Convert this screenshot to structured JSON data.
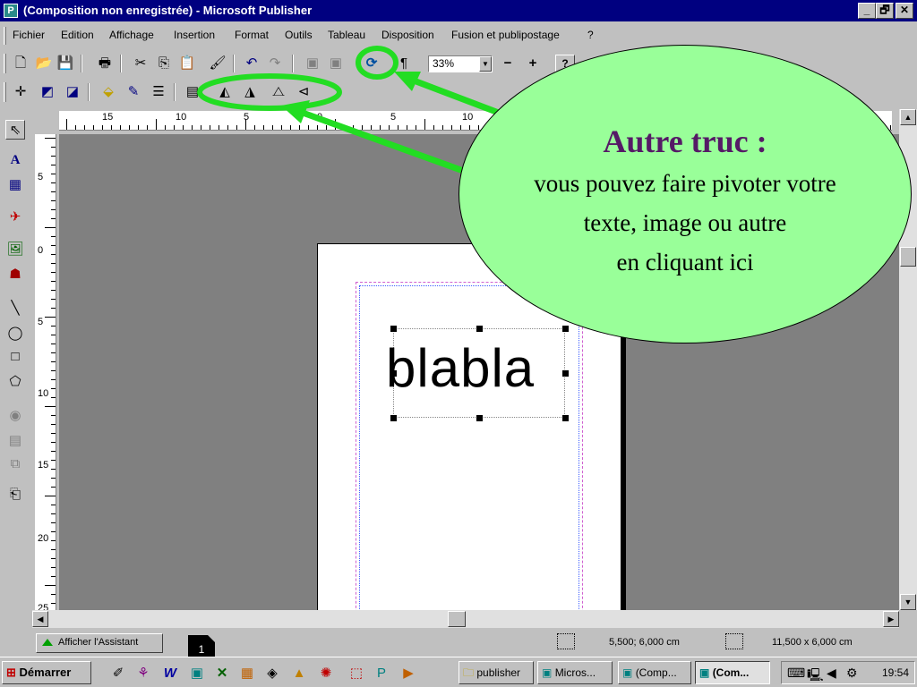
{
  "window": {
    "title": "(Composition non enregistrée) - Microsoft Publisher",
    "app_icon": "publisher-icon",
    "controls": [
      "_",
      "🗗",
      "✕"
    ]
  },
  "menubar": {
    "items": [
      "Fichier",
      "Edition",
      "Affichage",
      "Insertion",
      "Format",
      "Outils",
      "Tableau",
      "Disposition",
      "Fusion et publipostage",
      "?"
    ]
  },
  "toolbar_standard": {
    "zoom_value": "33%",
    "zoom_out": "−",
    "zoom_in": "+",
    "help": "?"
  },
  "rulers": {
    "horizontal_labels": [
      "15",
      "10",
      "5",
      "0",
      "5",
      "10"
    ],
    "vertical_labels": [
      "5",
      "0",
      "5",
      "10",
      "15",
      "20",
      "25"
    ]
  },
  "document": {
    "text": "blabla"
  },
  "annotation": {
    "title": "Autre truc :",
    "body_lines": [
      "vous pouvez faire pivoter votre",
      "texte, image ou autre",
      "en cliquant ici"
    ],
    "highlight_color": "#22dd22",
    "bubble_color": "#99ff99",
    "title_color": "#551a66"
  },
  "statusbar": {
    "assistant_label": "Afficher l'Assistant",
    "page_number": "1",
    "position": "5,500; 6,000 cm",
    "size": "11,500 x   6,000 cm"
  },
  "taskbar": {
    "start_label": "Démarrer",
    "tasks": [
      "publisher",
      "Micros...",
      "(Comp...",
      "(Com..."
    ],
    "clock": "19:54"
  },
  "colors": {
    "titlebar": "#000080",
    "chrome": "#c0c0c0",
    "workspace": "#808080"
  }
}
